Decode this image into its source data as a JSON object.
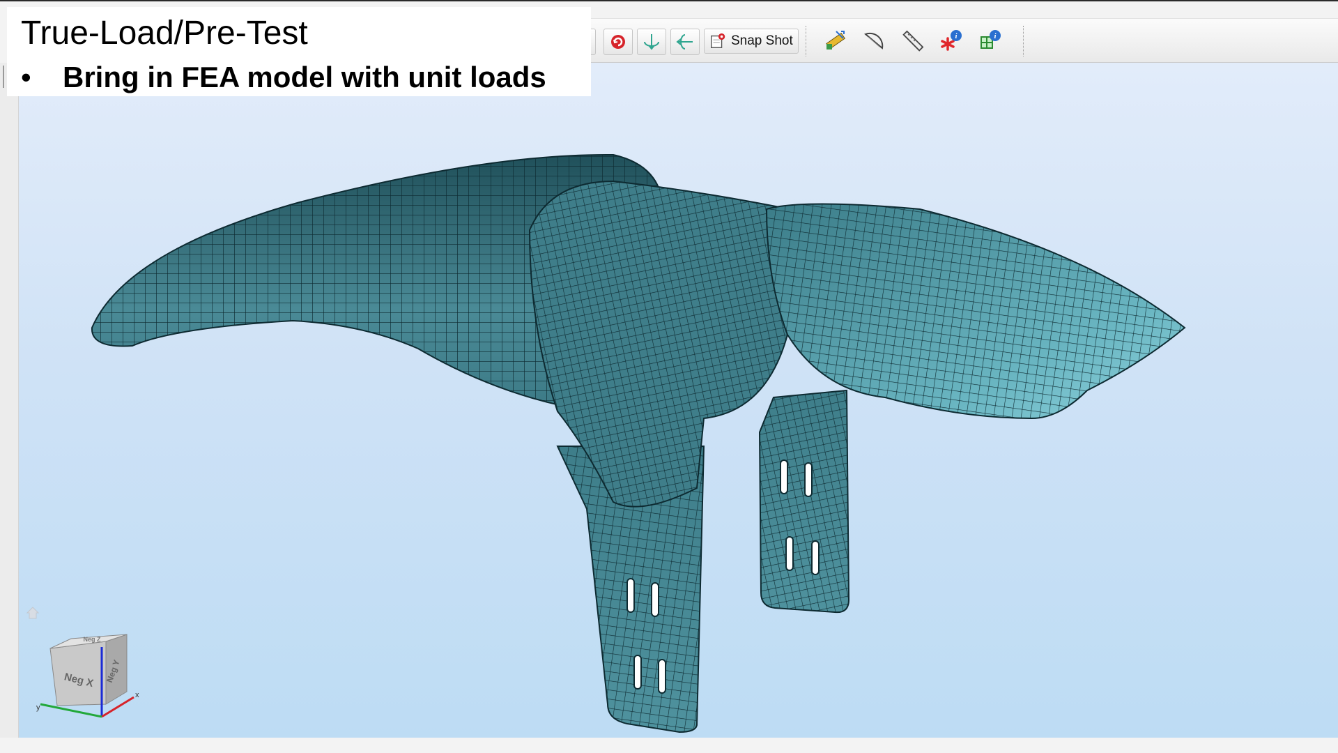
{
  "overlay": {
    "title": "True-Load/Pre-Test",
    "bullet": "Bring in FEA model with unit loads",
    "bullet_marker": "•"
  },
  "toolbar": {
    "snapshot_label": "Snap Shot",
    "icons": [
      "green-circle-icon",
      "red-rotate-icon",
      "axis-down-icon",
      "axis-left-icon",
      "camera-snapshot-icon",
      "ruler-measure-icon",
      "protractor-angle-icon",
      "ruler-line-icon",
      "node-info-icon",
      "element-info-icon"
    ]
  },
  "nav_cube": {
    "face_front": "Neg X",
    "face_side": "Neg Y",
    "face_top": "Neg Z",
    "axis_x": "x",
    "axis_y": "y"
  },
  "colors": {
    "mesh_fill": "#4a8a96",
    "mesh_line": "#0d2a31",
    "viewport_top": "#e2ecfa",
    "viewport_bottom": "#bddcf4"
  }
}
